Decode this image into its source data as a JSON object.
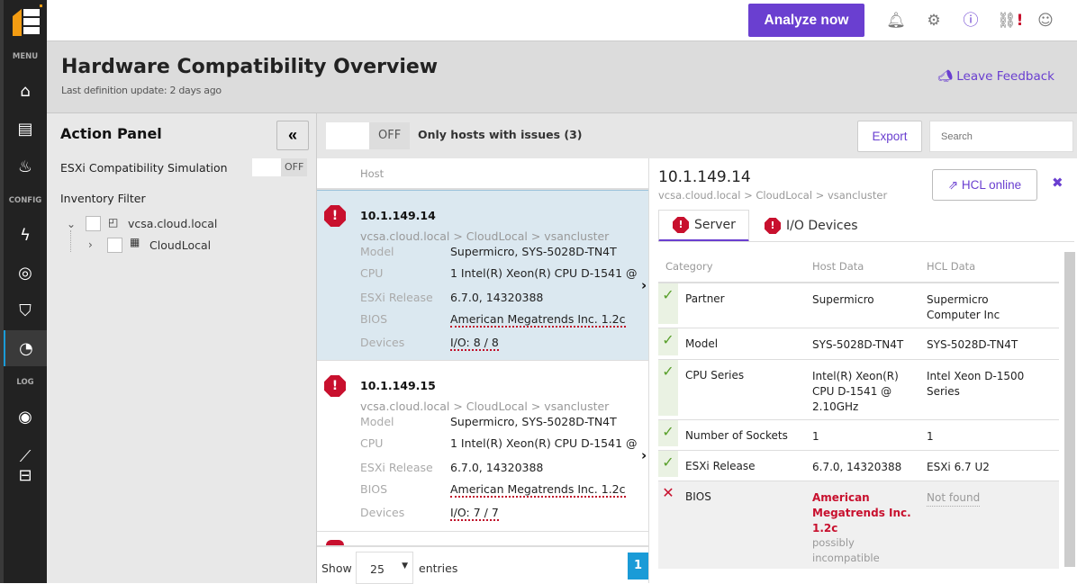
{
  "sidebar": {
    "sections": [
      "MENU",
      "CONFIG",
      "LOG"
    ],
    "items": [
      "home-icon",
      "book-icon",
      "fire-icon",
      "bolt-icon",
      "compass-icon",
      "shield-icon",
      "gauge-icon",
      "eye-icon",
      "chart-icon",
      "inbox-icon"
    ],
    "active": "gauge-icon"
  },
  "topbar": {
    "analyze_label": "Analyze now",
    "icons": [
      "bell-icon",
      "gear-icon",
      "help-icon",
      "link-alert-icon",
      "user-icon"
    ]
  },
  "header": {
    "title": "Hardware Compatibility Overview",
    "subtitle": "Last definition update: 2 days ago",
    "feedback": "Leave Feedback"
  },
  "action_panel": {
    "title": "Action Panel",
    "collapse": "«",
    "simulation_label": "ESXi Compatibility Simulation",
    "simulation_state": "OFF",
    "inventory_label": "Inventory Filter",
    "tree": [
      {
        "label": "vcsa.cloud.local",
        "expanded": true
      },
      {
        "label": "CloudLocal",
        "expanded": false
      }
    ]
  },
  "filter": {
    "toggle_state": "OFF",
    "label": "Only hosts with issues (3)",
    "export": "Export",
    "search_placeholder": "Search"
  },
  "list": {
    "column": "Host",
    "labels": {
      "model": "Model",
      "cpu": "CPU",
      "esxi": "ESXi Release",
      "bios": "BIOS",
      "devices": "Devices"
    },
    "hosts": [
      {
        "ip": "10.1.149.14",
        "path": "vcsa.cloud.local > CloudLocal > vsancluster",
        "model": "Supermicro, SYS-5028D-TN4T",
        "cpu": "1 Intel(R) Xeon(R) CPU D-1541 @",
        "esxi": "6.7.0, 14320388",
        "bios": "American Megatrends Inc. 1.2c",
        "devices": "I/O: 8 / 8"
      },
      {
        "ip": "10.1.149.15",
        "path": "vcsa.cloud.local > CloudLocal > vsancluster",
        "model": "Supermicro, SYS-5028D-TN4T",
        "cpu": "1 Intel(R) Xeon(R) CPU D-1541 @",
        "esxi": "6.7.0, 14320388",
        "bios": "American Megatrends Inc. 1.2c",
        "devices": "I/O: 7 / 7"
      }
    ],
    "show": "Show",
    "page_size": "25",
    "entries": "entries",
    "page": "1"
  },
  "detail": {
    "ip": "10.1.149.14",
    "path": "vcsa.cloud.local > CloudLocal > vsancluster",
    "hcl_online": "HCL online",
    "tabs": [
      "Server",
      "I/O Devices"
    ],
    "columns": [
      "Category",
      "Host Data",
      "HCL Data"
    ],
    "rows": [
      {
        "category": "Partner",
        "host": "Supermicro",
        "hcl": "Supermicro Computer Inc",
        "ok": true
      },
      {
        "category": "Model",
        "host": "SYS-5028D-TN4T",
        "hcl": "SYS-5028D-TN4T",
        "ok": true
      },
      {
        "category": "CPU Series",
        "host": "Intel(R) Xeon(R) CPU D-1541 @ 2.10GHz",
        "hcl": "Intel Xeon D-1500 Series",
        "ok": true
      },
      {
        "category": "Number of Sockets",
        "host": "1",
        "hcl": "1",
        "ok": true
      },
      {
        "category": "ESXi Release",
        "host": "6.7.0, 14320388",
        "hcl": "ESXi 6.7 U2",
        "ok": true
      },
      {
        "category": "BIOS",
        "host": "American Megatrends Inc. 1.2c",
        "host_note": "possibly incompatible",
        "hcl": "Not found",
        "ok": false
      }
    ]
  },
  "colors": {
    "accent": "#6a3fd0",
    "error": "#c8102e",
    "ok": "#5aa02c",
    "selected": "#dbe8f0"
  }
}
